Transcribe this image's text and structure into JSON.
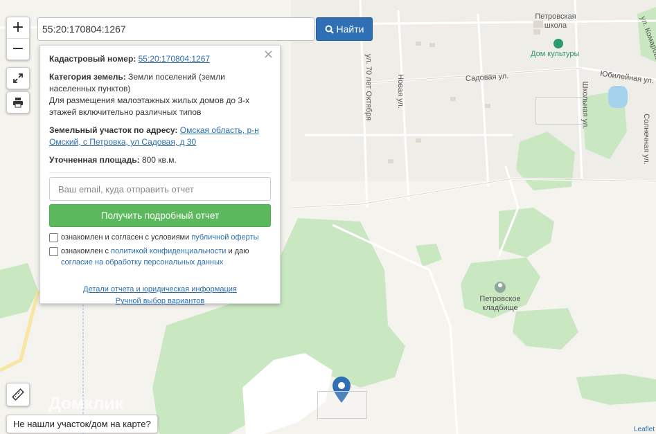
{
  "search": {
    "value": "55:20:170804:1267",
    "button_label": "Найти"
  },
  "zoom": {
    "in": "+",
    "out": "−"
  },
  "popup": {
    "cadastral_label": "Кадастровый номер:",
    "cadastral_value": "55:20:170804:1267",
    "category_label": "Категория земель:",
    "category_value": "Земли поселений (земли населенных пунктов)",
    "usage_text": "Для размещения малоэтажных жилых домов до 3-х этажей включительно различных типов",
    "address_label": "Земельный участок по адресу:",
    "address_value": "Омская область, р-н Омский, с Петровка, ул Садовая, д 30",
    "area_label": "Уточненная площадь:",
    "area_value": "800 кв.м.",
    "email_placeholder": "Ваш email, куда отправить отчет",
    "report_button": "Получить подробный отчет",
    "consent1_text": "ознакомлен и согласен с условиями",
    "consent1_link": "публичной оферты",
    "consent2_text_a": "ознакомлен с",
    "consent2_link_a": "политикой конфиденциальности",
    "consent2_text_b": "и даю",
    "consent2_link_b": "согласие на обработку персональных данных",
    "details_link": "Детали отчета и юридическая информация",
    "manual_link": "Ручной выбор вариантов",
    "close": "×"
  },
  "map": {
    "labels": {
      "school": "Петровская школа",
      "culture": "Дом культуры",
      "sadovaya": "Садовая ул.",
      "oktyabrya": "ул. 70 лет Октября",
      "novaya": "Новая ул.",
      "shkolnaya": "Школьная ул.",
      "yubileynaya": "Юбилейная ул.",
      "solnechnaya": "Солнечная ул.",
      "komarova": "ул. Комарова",
      "cemetery": "Петровское кладбище"
    },
    "watermark": "Домклик",
    "attribution": "Leaflet"
  },
  "not_found_button": "Не нашли участок/дом на карте?",
  "colors": {
    "primary": "#2f6fb3",
    "success": "#5cb85c",
    "forest": "#c9e8c2",
    "land": "#f5f3ee"
  }
}
